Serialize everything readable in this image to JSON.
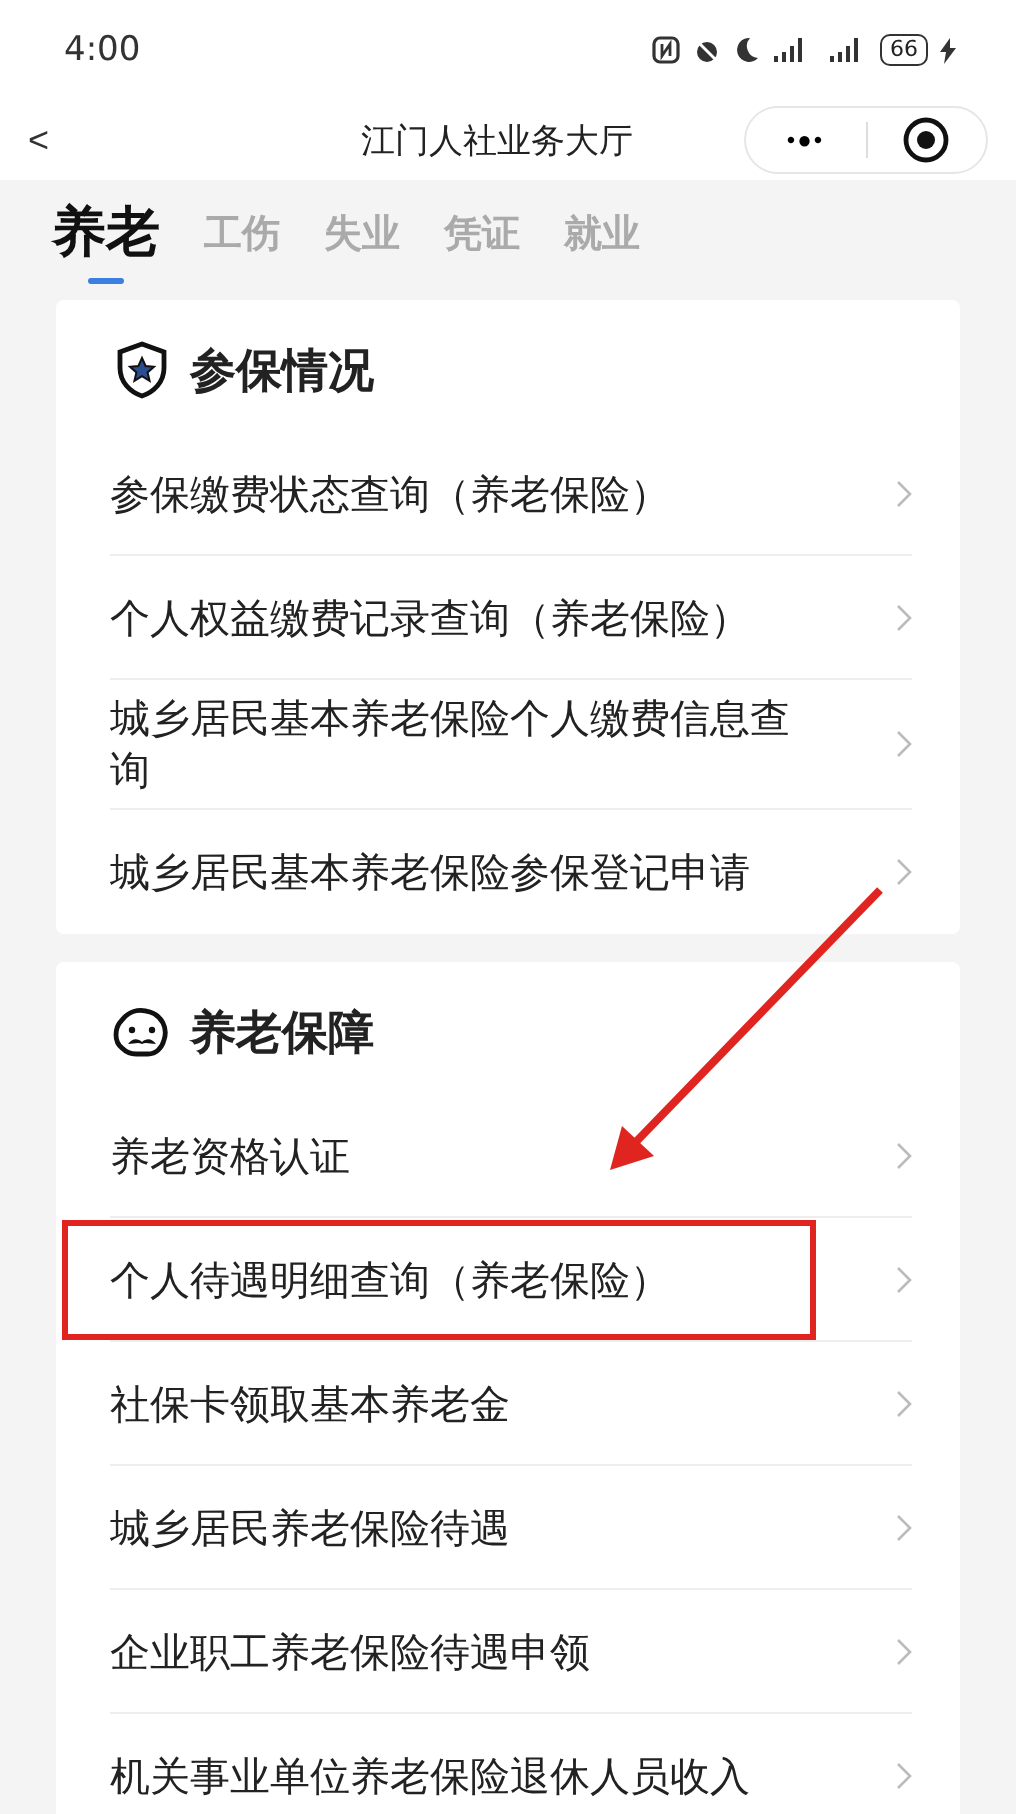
{
  "status_bar": {
    "time": "4:00",
    "battery": "66"
  },
  "nav": {
    "back": "<",
    "title": "江门人社业务大厅",
    "more": "•●•"
  },
  "tabs": [
    {
      "label": "养老",
      "selected": true
    },
    {
      "label": "工伤",
      "selected": false
    },
    {
      "label": "失业",
      "selected": false
    },
    {
      "label": "凭证",
      "selected": false
    },
    {
      "label": "就业",
      "selected": false
    }
  ],
  "sections": [
    {
      "title": "参保情况",
      "kind": "shield",
      "items": [
        {
          "label": "参保缴费状态查询（养老保险）",
          "highlighted": false
        },
        {
          "label": "个人权益缴费记录查询（养老保险）",
          "highlighted": false
        },
        {
          "label": "城乡居民基本养老保险个人缴费信息查询",
          "highlighted": false
        },
        {
          "label": "城乡居民基本养老保险参保登记申请",
          "highlighted": false
        }
      ]
    },
    {
      "title": "养老保障",
      "kind": "elder",
      "items": [
        {
          "label": "养老资格认证",
          "highlighted": false
        },
        {
          "label": "个人待遇明细查询（养老保险）",
          "highlighted": true
        },
        {
          "label": "社保卡领取基本养老金",
          "highlighted": false
        },
        {
          "label": "城乡居民养老保险待遇",
          "highlighted": false
        },
        {
          "label": "企业职工养老保险待遇申领",
          "highlighted": false
        },
        {
          "label": "机关事业单位养老保险退休人员收入",
          "highlighted": false
        }
      ]
    }
  ]
}
